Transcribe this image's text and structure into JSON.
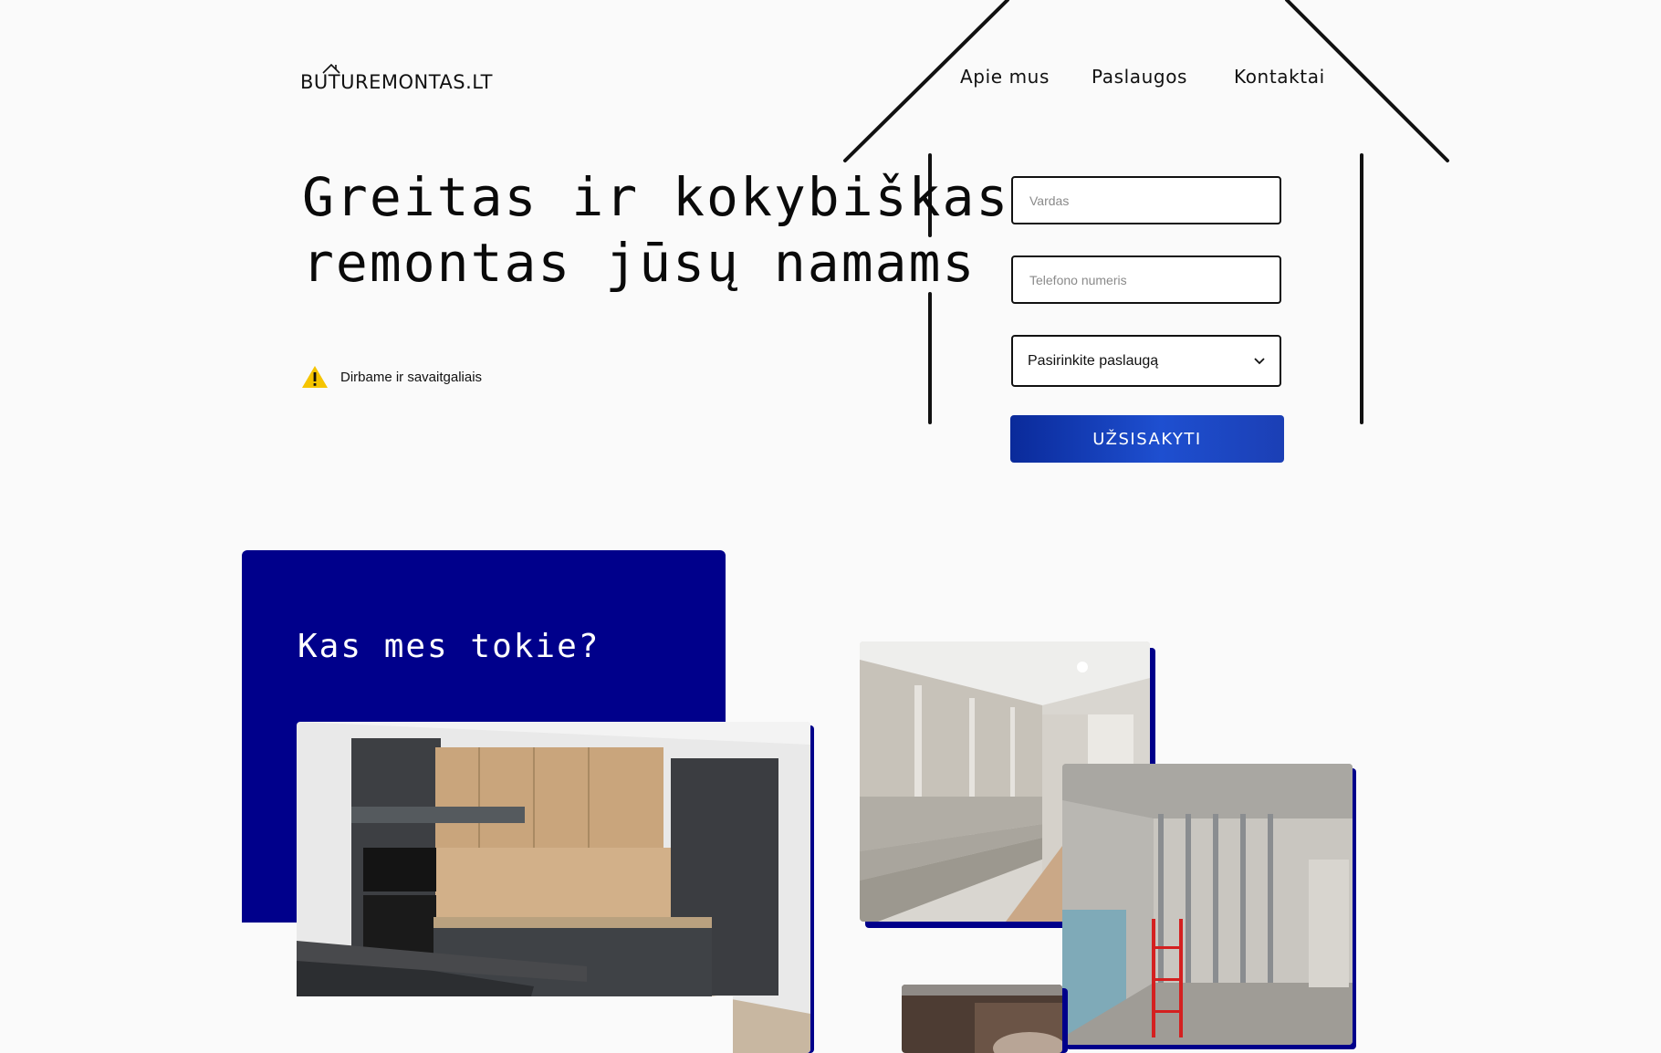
{
  "logo": {
    "text": "BUTUREMONTAS.LT"
  },
  "nav": [
    {
      "label": "Apie mus"
    },
    {
      "label": "Paslaugos"
    },
    {
      "label": "Kontaktai"
    }
  ],
  "hero": {
    "title_line1": "Greitas ir kokybiškas",
    "title_line2": "remontas jūsų namams",
    "weekend_note": "Dirbame ir savaitgaliais",
    "weekend_icon": "warning-icon"
  },
  "form": {
    "name_placeholder": "Vardas",
    "phone_placeholder": "Telefono numeris",
    "service_selected": "Pasirinkite paslaugą",
    "submit_label": "UŽSISAKYTI"
  },
  "about": {
    "title": "Kas mes tokie?"
  },
  "colors": {
    "brand_blue": "#00008b",
    "button_blue": "#1e4fd0",
    "warning_yellow": "#f5c400"
  }
}
